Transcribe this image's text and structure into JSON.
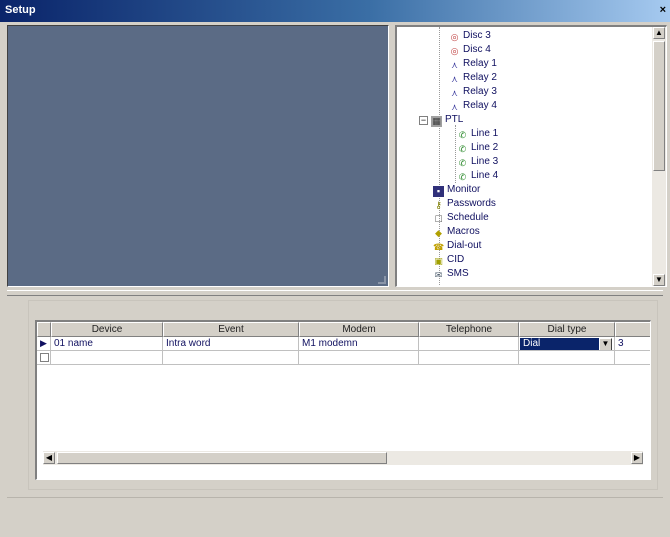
{
  "window": {
    "title": "Setup",
    "close_glyph": "×"
  },
  "tree": {
    "items": [
      {
        "label": "Disc 3",
        "icon": "disc-icon",
        "color": "#c04040"
      },
      {
        "label": "Disc 4",
        "icon": "disc-icon",
        "color": "#c04040"
      },
      {
        "label": "Relay 1",
        "icon": "relay-icon",
        "color": "#4040a0"
      },
      {
        "label": "Relay 2",
        "icon": "relay-icon",
        "color": "#4040a0"
      },
      {
        "label": "Relay 3",
        "icon": "relay-icon",
        "color": "#4040a0"
      },
      {
        "label": "Relay 4",
        "icon": "relay-icon",
        "color": "#4040a0"
      },
      {
        "label": "PTL",
        "icon": "ptl-icon",
        "color": "#404040"
      },
      {
        "label": "Line 1",
        "icon": "line-icon",
        "color": "#2e8b2e"
      },
      {
        "label": "Line 2",
        "icon": "line-icon",
        "color": "#2e8b2e"
      },
      {
        "label": "Line 3",
        "icon": "line-icon",
        "color": "#2e8b2e"
      },
      {
        "label": "Line 4",
        "icon": "line-icon",
        "color": "#2e8b2e"
      },
      {
        "label": "Monitor",
        "icon": "monitor-icon",
        "color": "#30307a"
      },
      {
        "label": "Passwords",
        "icon": "key-icon",
        "color": "#808000"
      },
      {
        "label": "Schedule",
        "icon": "schedule-icon",
        "color": "#606060"
      },
      {
        "label": "Macros",
        "icon": "macro-icon",
        "color": "#b0a000"
      },
      {
        "label": "Dial-out",
        "icon": "dial-icon",
        "color": "#c0a000"
      },
      {
        "label": "CID",
        "icon": "cid-icon",
        "color": "#a0a000"
      },
      {
        "label": "SMS",
        "icon": "sms-icon",
        "color": "#506070"
      }
    ],
    "expander_minus": "−"
  },
  "grid": {
    "columns": [
      "",
      "Device",
      "Event",
      "Modem",
      "Telephone",
      "Dial type",
      ""
    ],
    "rows": [
      {
        "marker": "▶",
        "device": "01 name",
        "event": "Intra word",
        "modem": "M1 modemn",
        "telephone": "",
        "dial_type": "Dial",
        "extra": "3"
      },
      {
        "marker": "",
        "device": "",
        "event": "",
        "modem": "",
        "telephone": "",
        "dial_type": "",
        "extra": ""
      }
    ],
    "combo_arrow": "▼"
  },
  "scroll": {
    "up": "▲",
    "down": "▼",
    "left": "◀",
    "right": "▶"
  }
}
